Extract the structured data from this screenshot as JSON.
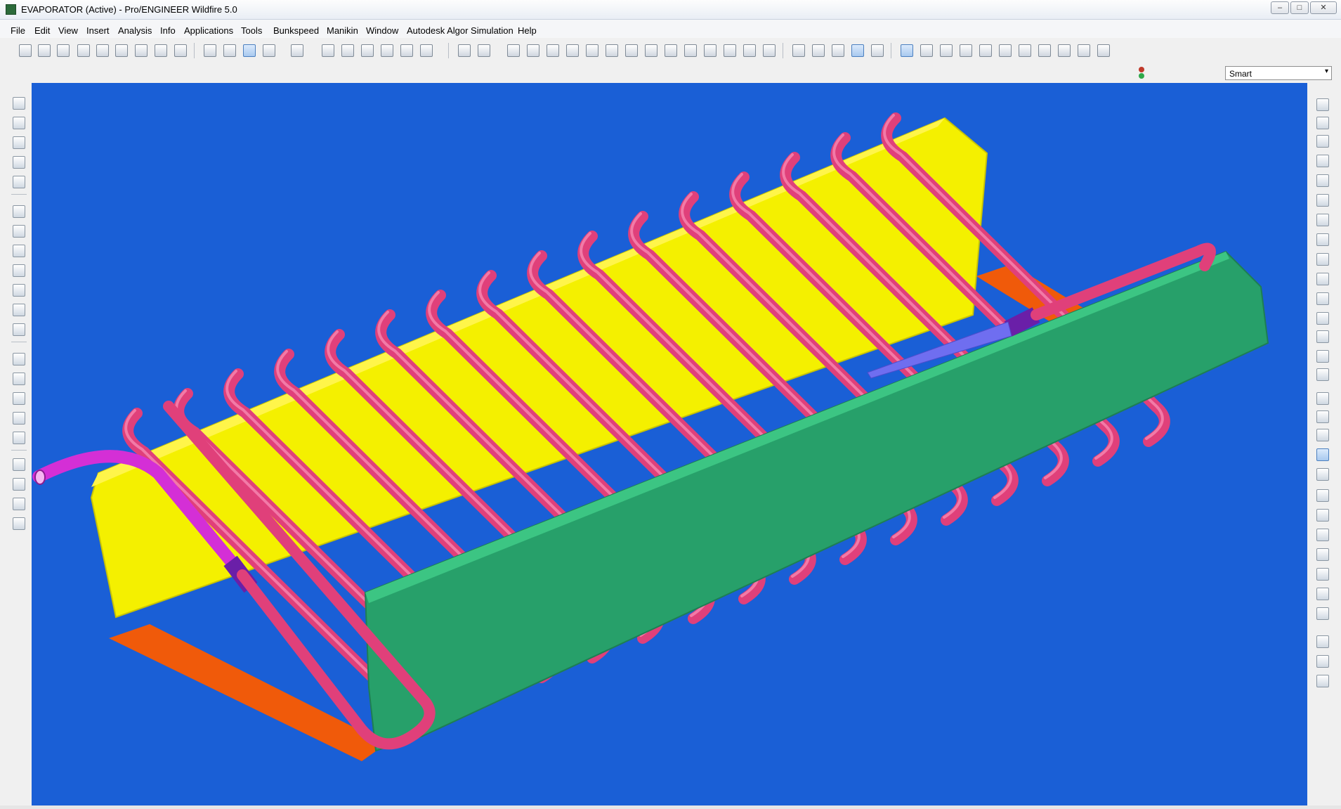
{
  "window": {
    "title": "EVAPORATOR (Active) - Pro/ENGINEER Wildfire 5.0",
    "minimize": "–",
    "maximize": "□",
    "close": "✕"
  },
  "menu": [
    "File",
    "Edit",
    "View",
    "Insert",
    "Analysis",
    "Info",
    "Applications",
    "Tools",
    "Bunkspeed",
    "Manikin",
    "Window",
    "Autodesk Algor Simulation",
    "Help"
  ],
  "filter": {
    "value": "Smart",
    "arrow": "▾"
  },
  "toolbar_icons": [
    "window-icon",
    "close-window-icon",
    "regenerate-icon",
    "new-icon",
    "open-icon",
    "save-icon",
    "edit-icon",
    "print-icon",
    "email-icon",
    "video-icon",
    "sketch-icon",
    "select-icon",
    "undo-icon",
    "redo-icon",
    "cut-icon",
    "copy-icon",
    "paste-icon",
    "paste-special-icon",
    "binoculars-icon",
    "select-box-icon",
    "coord-sys-icon",
    "appearance-icon",
    "model-tree-icon",
    "connect-icon",
    "spin-icon",
    "pan-icon",
    "zoom-in-icon",
    "zoom-out-icon",
    "fit-icon",
    "refit-icon",
    "reorient-icon",
    "saved-views-icon",
    "layers-icon",
    "view-manager-icon",
    "measure-icon",
    "wireframe-icon",
    "hidden-line-icon",
    "no-hidden-icon",
    "shading-icon",
    "realtime-render-icon",
    "datum-planes-icon",
    "datum-axes-icon",
    "point-icon",
    "csys-display-icon",
    "annotation-icon",
    "display-icon",
    "datum-plane-tool-icon",
    "datum-axis-tool-icon",
    "datum-point-tool-icon",
    "close-icon"
  ],
  "left_icons": [
    "extrude-icon",
    "revolve-icon",
    "sweep-icon",
    "blend-icon",
    "boundary-icon",
    "hole-icon",
    "shell-icon",
    "rib-icon",
    "draft-icon",
    "round-icon",
    "chamfer-icon",
    "rectangle-icon",
    "mirror-icon",
    "pattern-icon",
    "trim-icon",
    "merge-icon",
    "style-icon",
    "table-icon",
    "flexible-icon"
  ],
  "right_icons": [
    "binoculars-icon",
    "layers-icon",
    "regenerate-icon",
    "window-icon",
    "open-icon",
    "save-icon",
    "edit-icon",
    "export-icon",
    "view-icon",
    "zoom-in-icon",
    "zoom-out-icon",
    "refit-icon",
    "spin-icon",
    "reorient-icon",
    "saved-views-icon",
    "wireframe-icon",
    "hidden-line-icon",
    "no-hidden-icon",
    "shading-icon",
    "surface-icon",
    "plane-icon",
    "datum-plane-icon",
    "axis-icon",
    "curve-icon",
    "point-icon",
    "csys-icon",
    "close-icon",
    "sketch-icon",
    "analysis-icon",
    "feature-icon"
  ],
  "colors": {
    "viewport": "#1a5fd6",
    "yellow_bracket": "#f4f000",
    "green_bracket": "#27a06a",
    "tube": "#e0407a",
    "magenta_tube": "#d42fd6",
    "orange_plate": "#f05a0a",
    "purple_sleeve": "#6a1fa8",
    "blue_nozzle": "#6f6ef0"
  }
}
